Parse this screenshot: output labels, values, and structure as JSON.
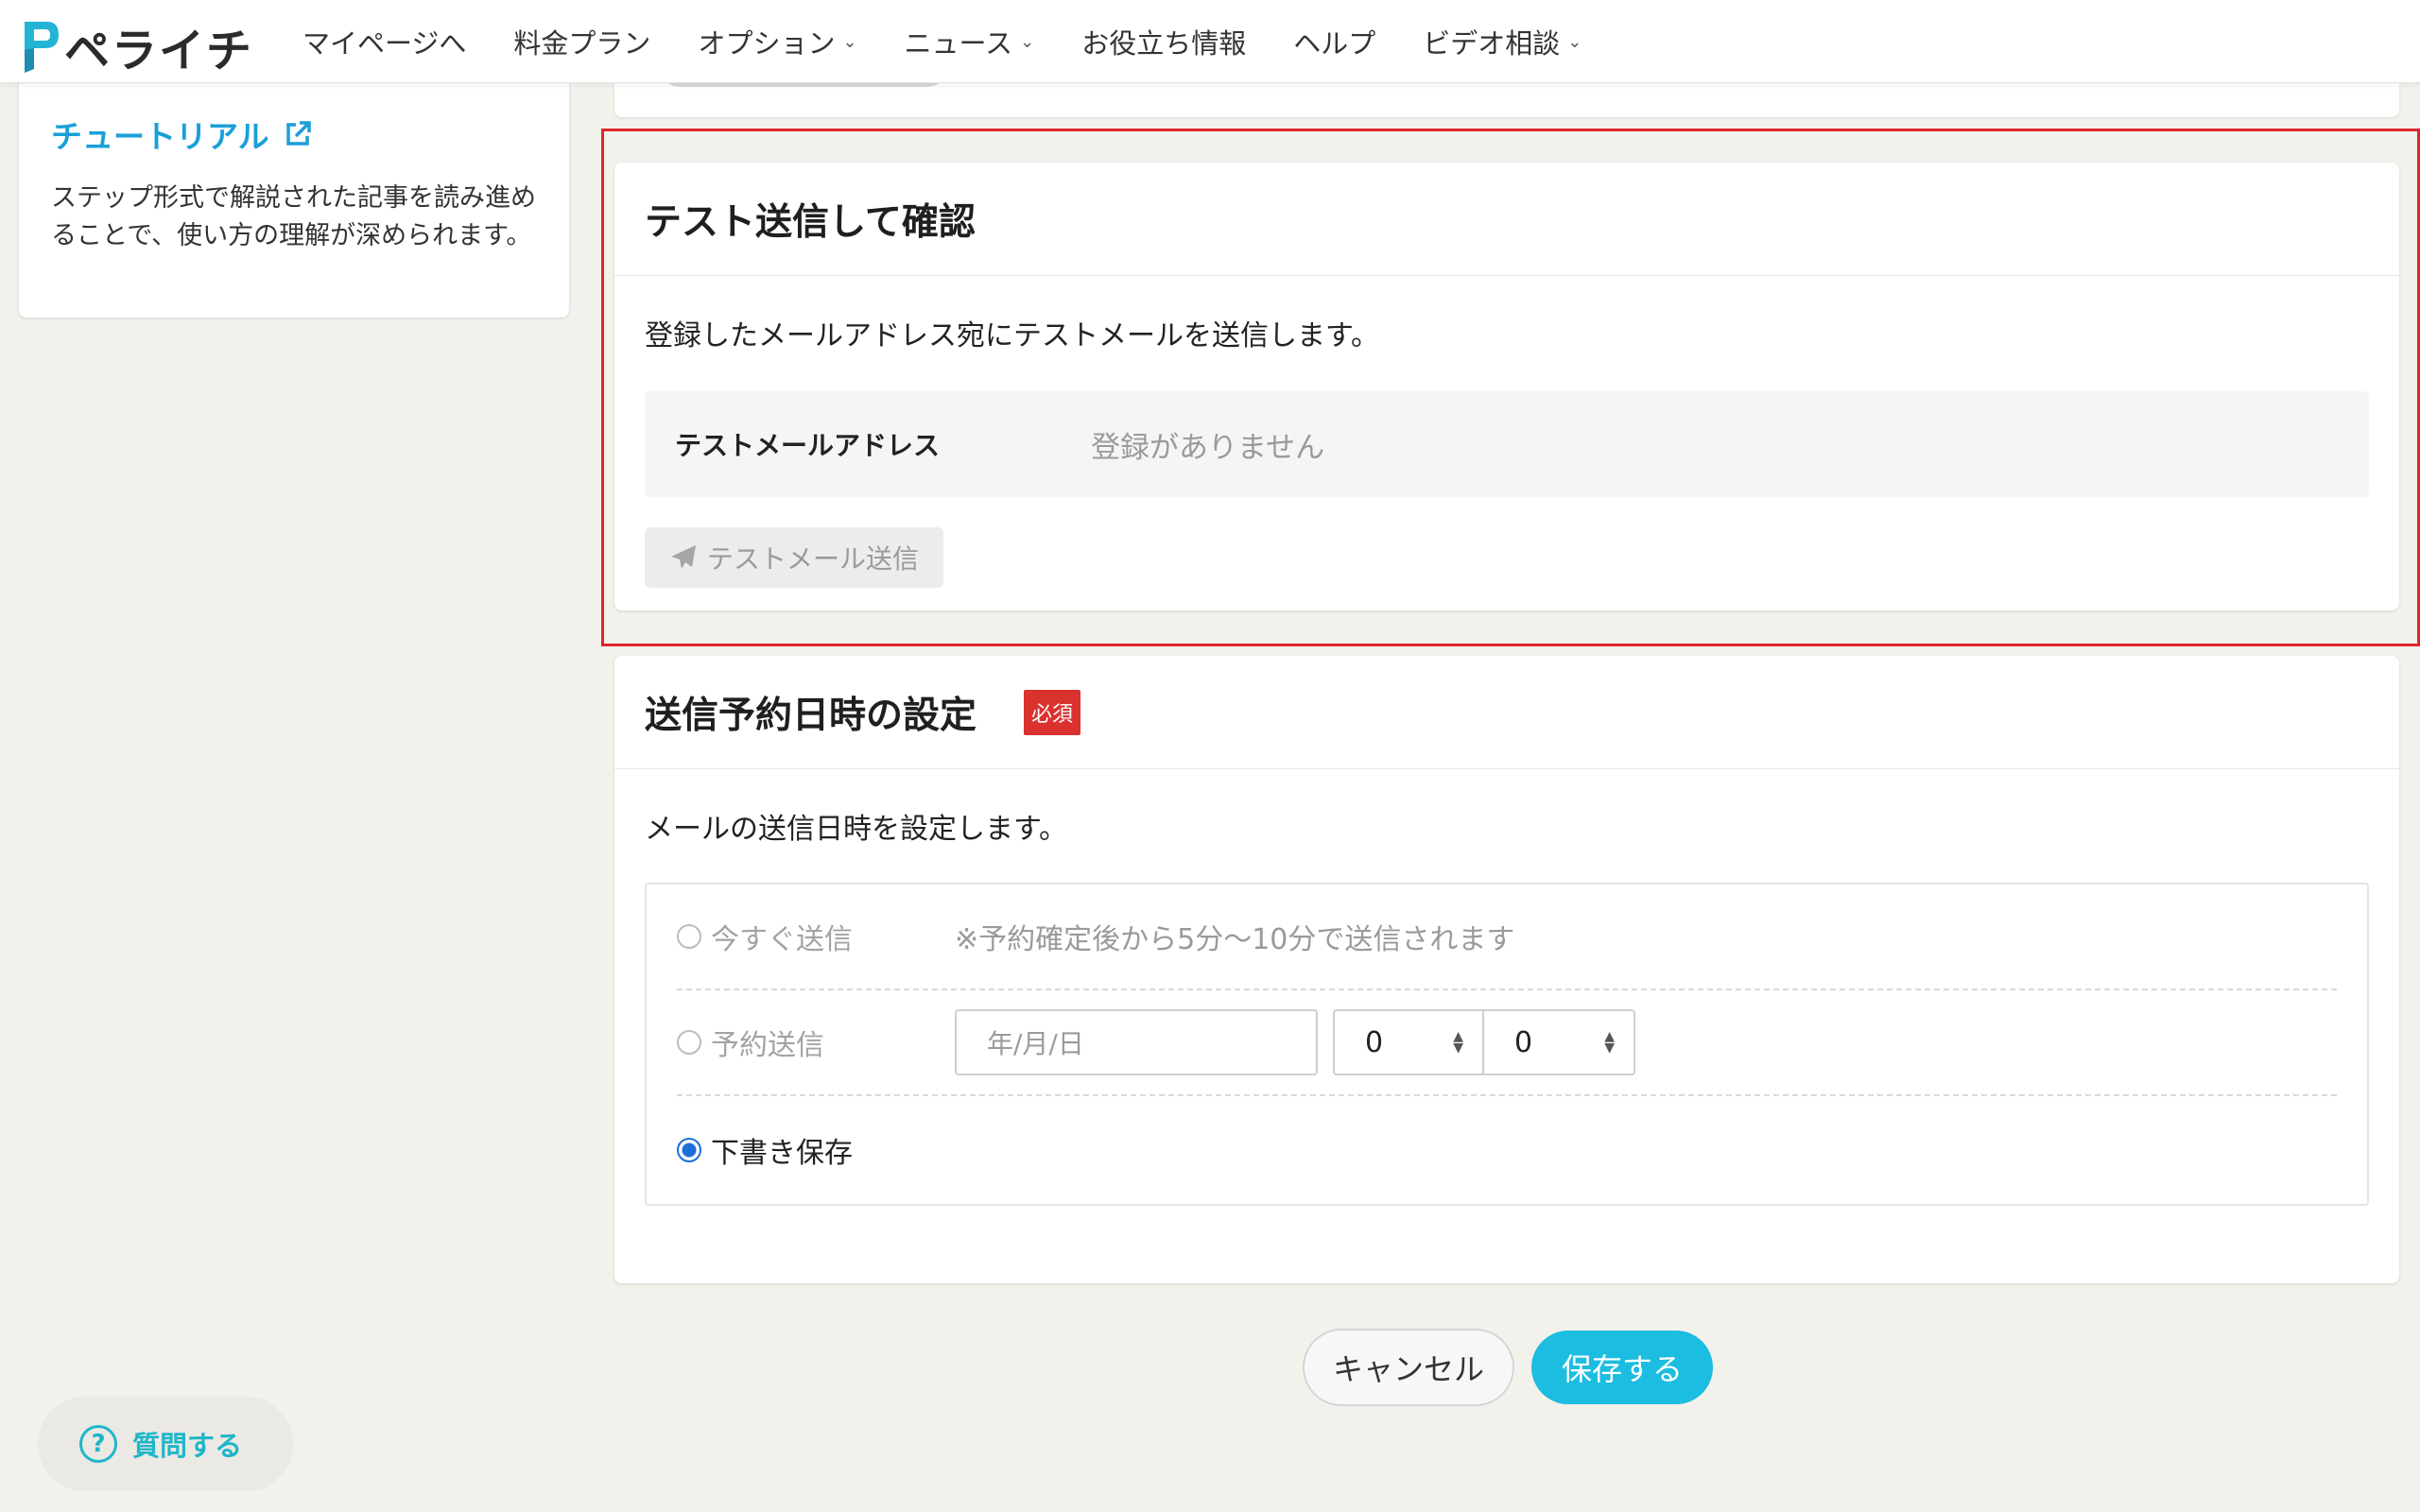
{
  "header": {
    "logo_text": "ペライチ",
    "nav": [
      {
        "label": "マイページへ",
        "has_dropdown": false
      },
      {
        "label": "料金プラン",
        "has_dropdown": false
      },
      {
        "label": "オプション",
        "has_dropdown": true
      },
      {
        "label": "ニュース",
        "has_dropdown": true
      },
      {
        "label": "お役立ち情報",
        "has_dropdown": false
      },
      {
        "label": "ヘルプ",
        "has_dropdown": false
      },
      {
        "label": "ビデオ相談",
        "has_dropdown": true
      }
    ]
  },
  "sidebar": {
    "tutorial_link": "チュートリアル",
    "tutorial_desc": "ステップ形式で解説された記事を読み進めることで、使い方の理解が深められます。",
    "help_button": "質問する"
  },
  "test_send": {
    "title": "テスト送信して確認",
    "description": "登録したメールアドレス宛にテストメールを送信します。",
    "email_label": "テストメールアドレス",
    "email_value": "登録がありません",
    "send_button": "テストメール送信"
  },
  "schedule": {
    "title": "送信予約日時の設定",
    "required_badge": "必須",
    "description": "メールの送信日時を設定します。",
    "options": {
      "now_label": "今すぐ送信",
      "now_note": "※予約確定後から5分〜10分で送信されます",
      "reserve_label": "予約送信",
      "date_placeholder": "年/月/日",
      "hour_value": "0",
      "minute_value": "0",
      "draft_label": "下書き保存"
    },
    "selected": "下書き保存"
  },
  "footer": {
    "cancel_button": "キャンセル",
    "save_button": "保存する"
  },
  "colors": {
    "accent": "#1cbde0",
    "link": "#1a9fd9",
    "required": "#d9322f",
    "highlight_border": "#e0262b",
    "radio_selected": "#1b6fd8"
  }
}
